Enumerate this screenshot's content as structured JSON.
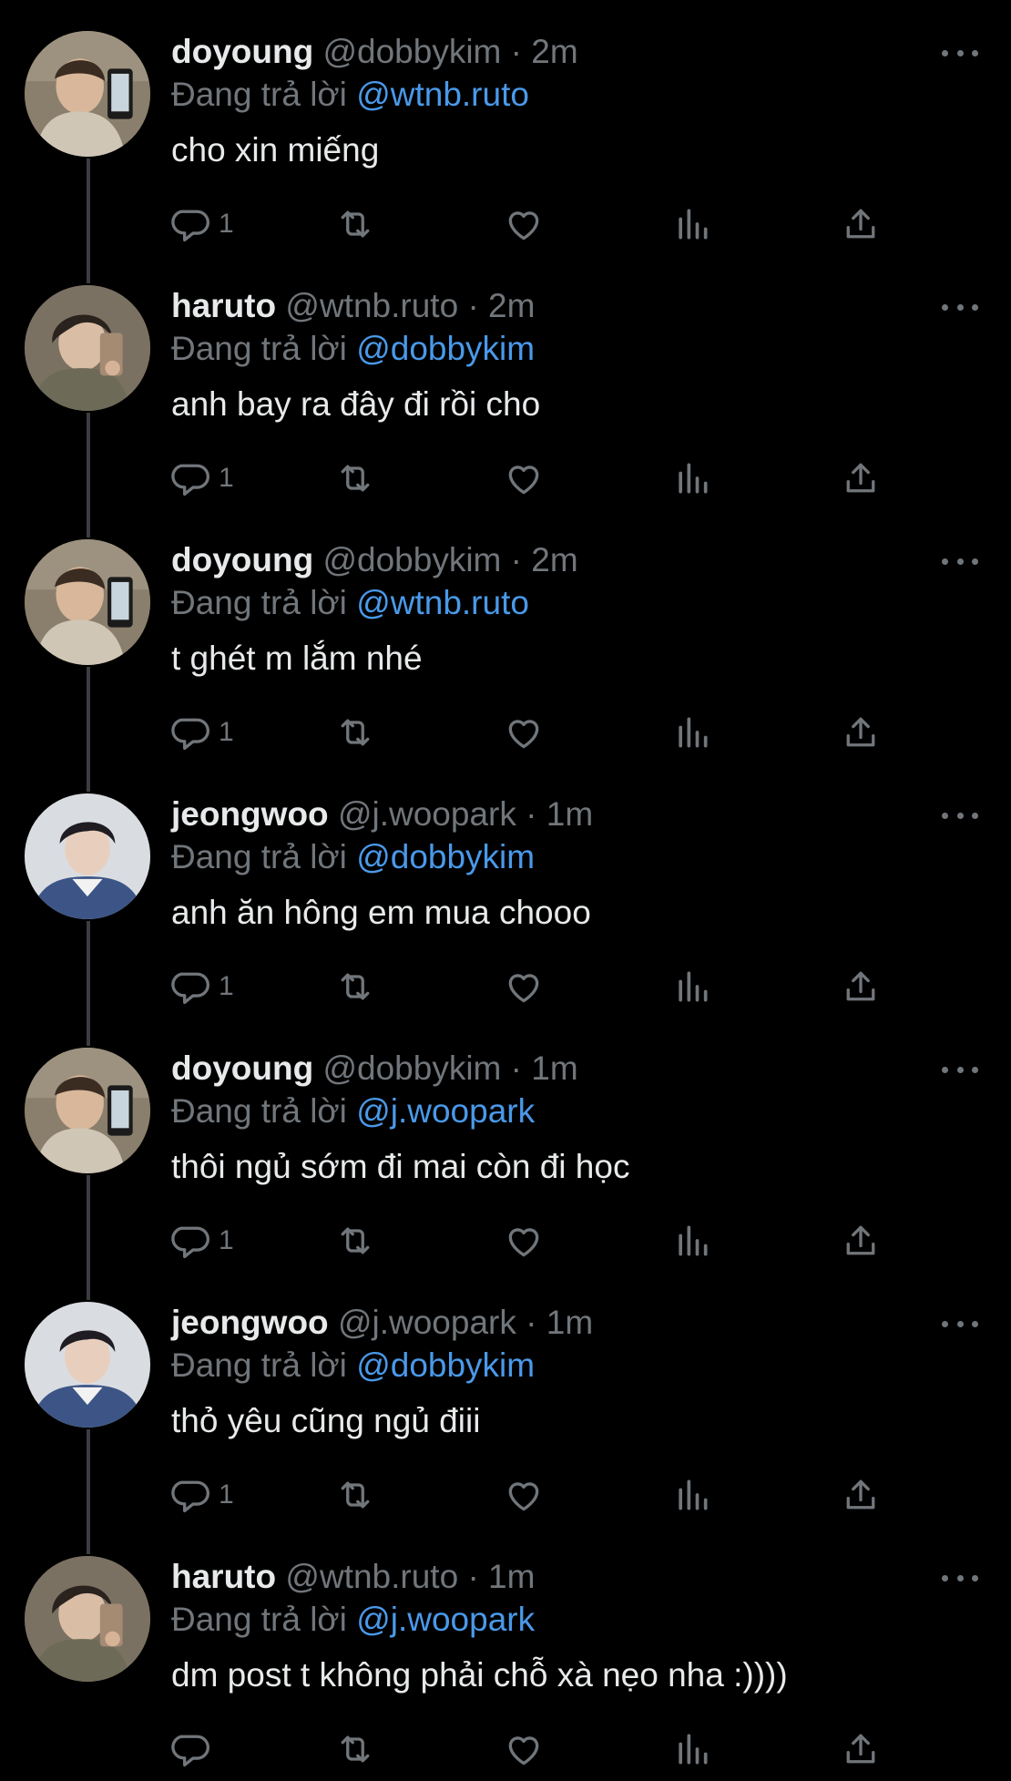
{
  "replying_prefix": "Đang trả lời",
  "dot": "·",
  "tweets": [
    {
      "name": "doyoung",
      "handle": "@dobbykim",
      "time": "2m",
      "replying_to": "@wtnb.ruto",
      "text": "cho xin miếng",
      "reply_count": "1",
      "avatar": "doyoung-avatar"
    },
    {
      "name": "haruto",
      "handle": "@wtnb.ruto",
      "time": "2m",
      "replying_to": "@dobbykim",
      "text": "anh bay ra đây đi rồi cho",
      "reply_count": "1",
      "avatar": "haruto-avatar"
    },
    {
      "name": "doyoung",
      "handle": "@dobbykim",
      "time": "2m",
      "replying_to": "@wtnb.ruto",
      "text": "t ghét m lắm nhé",
      "reply_count": "1",
      "avatar": "doyoung-avatar"
    },
    {
      "name": "jeongwoo",
      "handle": "@j.woopark",
      "time": "1m",
      "replying_to": "@dobbykim",
      "text": "anh ăn hông em mua chooo",
      "reply_count": "1",
      "avatar": "jeongwoo-avatar"
    },
    {
      "name": "doyoung",
      "handle": "@dobbykim",
      "time": "1m",
      "replying_to": "@j.woopark",
      "text": "thôi ngủ sớm đi mai còn đi học",
      "reply_count": "1",
      "avatar": "doyoung-avatar"
    },
    {
      "name": "jeongwoo",
      "handle": "@j.woopark",
      "time": "1m",
      "replying_to": "@dobbykim",
      "text": "thỏ yêu cũng ngủ điii",
      "reply_count": "1",
      "avatar": "jeongwoo-avatar"
    },
    {
      "name": "haruto",
      "handle": "@wtnb.ruto",
      "time": "1m",
      "replying_to": "@j.woopark",
      "text": "dm post t không phải chỗ xà nẹo nha :))))",
      "reply_count": "",
      "avatar": "haruto-avatar"
    }
  ],
  "colors": {
    "background": "#000000",
    "text": "#e7e9ea",
    "muted": "#71767b",
    "link": "#4a99e9",
    "thread_line": "#3a3d40"
  },
  "icons": [
    "reply-icon",
    "retweet-icon",
    "like-icon",
    "views-icon",
    "share-icon",
    "more-icon"
  ]
}
